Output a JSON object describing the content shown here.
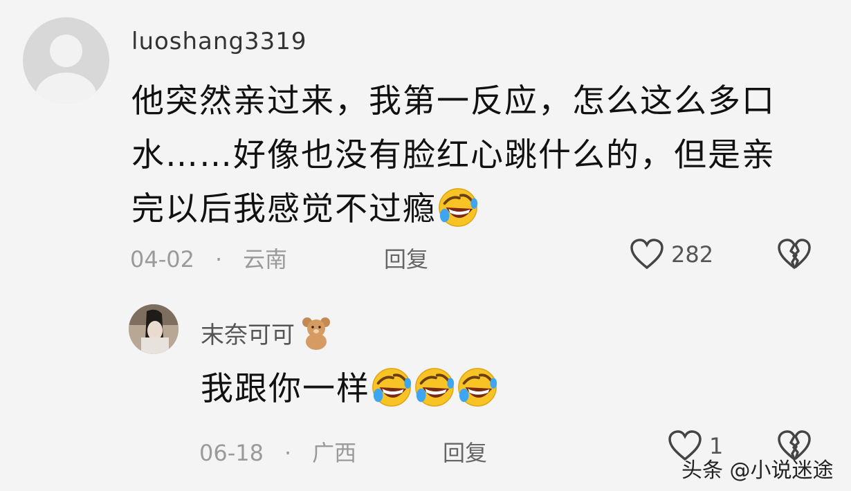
{
  "comments": [
    {
      "username": "luoshang3319",
      "text": "他突然亲过来，我第一反应，怎么这么多口水……好像也没有脸红心跳什么的，但是亲完以后我感觉不过瘾",
      "date": "04-02",
      "separator": "·",
      "location": "云南",
      "reply_label": "回复",
      "likes": "282",
      "emoji": "rolling-laugh"
    },
    {
      "username": "末奈可可",
      "text": "我跟你一样",
      "date": "06-18",
      "separator": "·",
      "location": "广西",
      "reply_label": "回复",
      "likes": "1",
      "emoji": "rolling-laugh",
      "emoji_count": 3,
      "name_badge": "teddy-bear"
    }
  ],
  "watermark": "头条 @小说迷途",
  "colors": {
    "background": "#f4f4f4",
    "emoji_yellow": "#f7c325",
    "meta_gray": "#9a9a9a"
  }
}
